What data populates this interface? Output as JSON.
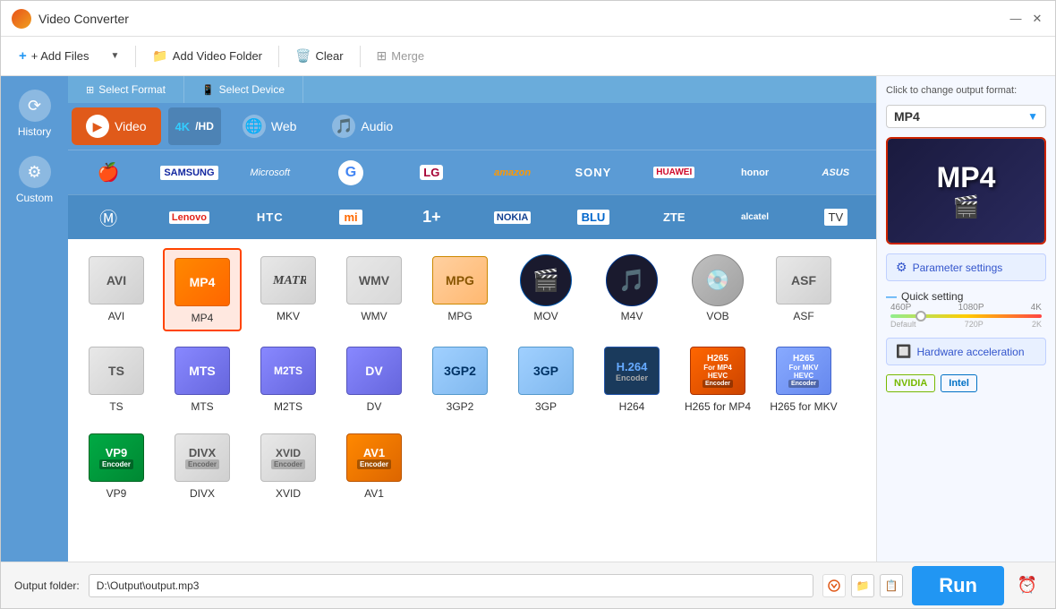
{
  "window": {
    "title": "Video Converter",
    "icon_color": "#e8521a"
  },
  "toolbar": {
    "add_files_label": "+ Add Files",
    "add_video_folder_label": "Add Video Folder",
    "clear_label": "Clear",
    "merge_label": "Merge"
  },
  "sidebar": {
    "history_label": "History",
    "custom_label": "Custom"
  },
  "format_panel": {
    "select_format_tab": "Select Format",
    "select_device_tab": "Select Device",
    "video_label": "Video",
    "web_label": "Web",
    "audio_label": "Audio",
    "4k_label": "4K/HD"
  },
  "brands_row1": [
    "Apple",
    "SAMSUNG",
    "Microsoft",
    "Google",
    "LG",
    "amazon",
    "SONY",
    "HUAWEI",
    "honor",
    "ASUS"
  ],
  "brands_row2": [
    "Motorola",
    "Lenovo",
    "HTC",
    "Mi",
    "1+",
    "NOKIA",
    "BLU",
    "ZTE",
    "alcatel",
    "TV"
  ],
  "formats": [
    {
      "id": "avi",
      "label": "AVI"
    },
    {
      "id": "mp4",
      "label": "MP4",
      "selected": true
    },
    {
      "id": "mkv",
      "label": "MKV"
    },
    {
      "id": "wmv",
      "label": "WMV"
    },
    {
      "id": "mpg",
      "label": "MPG"
    },
    {
      "id": "mov",
      "label": "MOV"
    },
    {
      "id": "m4v",
      "label": "M4V"
    },
    {
      "id": "vob",
      "label": "VOB"
    },
    {
      "id": "asf",
      "label": "ASF"
    },
    {
      "id": "ts",
      "label": "TS"
    },
    {
      "id": "mts",
      "label": "MTS"
    },
    {
      "id": "m2ts",
      "label": "M2TS"
    },
    {
      "id": "dv",
      "label": "DV"
    },
    {
      "id": "3gp2",
      "label": "3GP2"
    },
    {
      "id": "3gp",
      "label": "3GP"
    },
    {
      "id": "h264",
      "label": "H264"
    },
    {
      "id": "h265mp4",
      "label": "H265 for MP4"
    },
    {
      "id": "h265mkv",
      "label": "H265 for MKV"
    },
    {
      "id": "vp9",
      "label": "VP9"
    },
    {
      "id": "divx",
      "label": "DIVX"
    },
    {
      "id": "xvid",
      "label": "XVID"
    },
    {
      "id": "av1",
      "label": "AV1"
    }
  ],
  "right_panel": {
    "hint": "Click to change output format:",
    "selected_format": "MP4",
    "param_settings_label": "Parameter settings",
    "quick_setting_label": "Quick setting",
    "quality_labels": [
      "460P",
      "1080P",
      "4K"
    ],
    "quality_sublabels": [
      "Default",
      "720P",
      "2K"
    ],
    "hw_accel_label": "Hardware acceleration",
    "nvidia_label": "NVIDIA",
    "intel_label": "Intel"
  },
  "bottom_bar": {
    "output_label": "Output folder:",
    "output_path": "D:\\Output\\output.mp3",
    "run_label": "Run"
  }
}
